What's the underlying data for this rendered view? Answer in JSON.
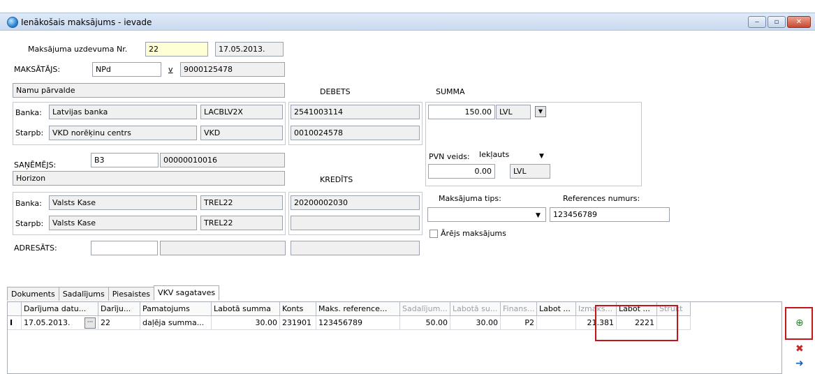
{
  "window": {
    "title": "Ienākošais maksājums - ievade",
    "min": "‒",
    "max": "▫",
    "close": "✕"
  },
  "header": {
    "order_label": "Maksājuma uzdevuma Nr.",
    "order_no": "22",
    "date": "17.05.2013.",
    "payer_label": "MAKSĀTĀJS:",
    "payer_code": "NPd",
    "payer_v": "v",
    "payer_reg": "9000125478",
    "payer_name": "Namu pārvalde",
    "bank_label": "Banka:",
    "payer_bank": "Latvijas banka",
    "payer_bic": "LACBLV2X",
    "starpb_label": "Starpb:",
    "payer_starpb": "VKD norēķinu centrs",
    "payer_starpb_code": "VKD",
    "debets_label": "DEBETS",
    "debets_1": "2541003114",
    "debets_2": "0010024578",
    "summa_label": "SUMMA",
    "summa": "150.00",
    "currency": "LVL",
    "pvn_label": "PVN veids:",
    "pvn_type": "Iekļauts",
    "pvn_amount": "0.00",
    "pvn_currency": "LVL",
    "receiver_label": "SAŅĒMĒJS:",
    "receiver_code": "B3",
    "receiver_reg": "00000010016",
    "receiver_name": "Horizon",
    "kredits_label": "KREDĪTS",
    "receiver_bank": "Valsts Kase",
    "receiver_bic": "TREL22",
    "kredits_1": "20200002030",
    "receiver_starpb": "Valsts Kase",
    "receiver_starpb_code": "TREL22",
    "pay_type_label": "Maksājuma tips:",
    "ref_label": "References numurs:",
    "ref_no": "123456789",
    "external_label": "Ārējs maksājums",
    "adresats_label": "ADRESĀTS:"
  },
  "tabs": [
    "Dokuments",
    "Sadalījums",
    "Piesaistes",
    "VKV sagataves"
  ],
  "grid": {
    "columns": [
      "Darījuma datu...",
      "Darīju...",
      "Pamatojums",
      "Labotā summa",
      "Konts",
      "Maks. reference...",
      "Sadalījum...",
      "Labotā su...",
      "Finans...",
      "Labot ...",
      "Izmaks...",
      "Labot ...",
      "Strukt"
    ],
    "row": [
      "17.05.2013.",
      "22",
      "daļēja summa...",
      "30.00",
      "231901",
      "123456789",
      "50.00",
      "30.00",
      "P2",
      "",
      "21.381",
      "2221",
      ""
    ]
  },
  "side": {
    "add": "⊕",
    "delete": "✖",
    "export": "➜"
  }
}
